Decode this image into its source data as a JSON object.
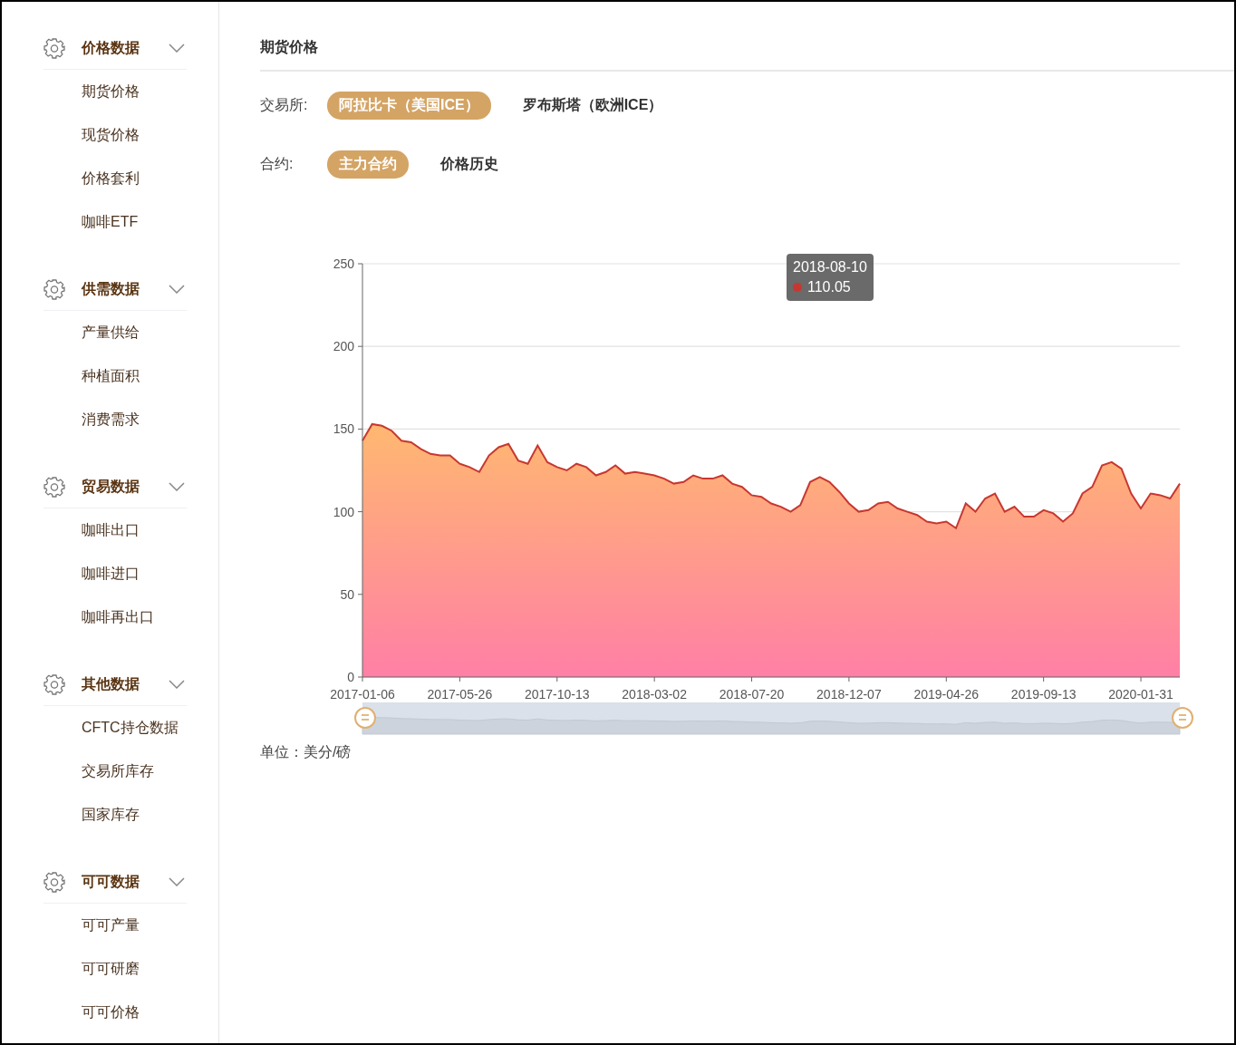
{
  "sidebar": {
    "sections": [
      {
        "title": "价格数据",
        "items": [
          "期货价格",
          "现货价格",
          "价格套利",
          "咖啡ETF"
        ]
      },
      {
        "title": "供需数据",
        "items": [
          "产量供给",
          "种植面积",
          "消费需求"
        ]
      },
      {
        "title": "贸易数据",
        "items": [
          "咖啡出口",
          "咖啡进口",
          "咖啡再出口"
        ]
      },
      {
        "title": "其他数据",
        "items": [
          "CFTC持仓数据",
          "交易所库存",
          "国家库存"
        ]
      },
      {
        "title": "可可数据",
        "items": [
          "可可产量",
          "可可研磨",
          "可可价格"
        ]
      }
    ]
  },
  "main": {
    "title": "期货价格",
    "filters": [
      {
        "label": "交易所:",
        "options": [
          {
            "label": "阿拉比卡（美国ICE）",
            "selected": true
          },
          {
            "label": "罗布斯塔（欧洲ICE）",
            "selected": false
          }
        ]
      },
      {
        "label": "合约:",
        "options": [
          {
            "label": "主力合约",
            "selected": true
          },
          {
            "label": "价格历史",
            "selected": false
          }
        ]
      }
    ],
    "chart_data": {
      "type": "area",
      "grid": true,
      "ylim": [
        0,
        250
      ],
      "yticks": [
        0,
        50,
        100,
        150,
        200,
        250
      ],
      "categories": [
        "2017-01-06",
        null,
        null,
        null,
        null,
        null,
        null,
        null,
        null,
        null,
        "2017-05-26",
        null,
        null,
        null,
        null,
        null,
        null,
        null,
        null,
        null,
        "2017-10-13",
        null,
        null,
        null,
        null,
        null,
        null,
        null,
        null,
        null,
        "2018-03-02",
        null,
        null,
        null,
        null,
        null,
        null,
        null,
        null,
        null,
        "2018-07-20",
        null,
        null,
        null,
        null,
        null,
        null,
        null,
        null,
        null,
        "2018-12-07",
        null,
        null,
        null,
        null,
        null,
        null,
        null,
        null,
        null,
        "2019-04-26",
        null,
        null,
        null,
        null,
        null,
        null,
        null,
        null,
        null,
        "2019-09-13",
        null,
        null,
        null,
        null,
        null,
        null,
        null,
        null,
        null,
        "2020-01-31",
        null,
        null,
        null,
        null
      ],
      "series": [
        {
          "color": "#c8372f",
          "values": [
            143,
            153,
            152,
            149,
            143,
            142,
            138,
            135,
            134,
            134,
            129,
            127,
            124,
            134,
            139,
            141,
            131,
            129,
            140,
            130,
            127,
            125,
            129,
            127,
            122,
            124,
            128,
            123,
            124,
            123,
            122,
            120,
            117,
            118,
            122,
            120,
            120,
            122,
            117,
            115,
            110,
            109,
            105,
            103,
            100,
            104,
            118,
            121,
            118,
            112,
            105,
            100,
            101,
            105,
            106,
            102,
            100,
            98,
            94,
            93,
            94,
            90,
            105,
            100,
            108,
            111,
            100,
            103,
            97,
            97,
            101,
            99,
            94,
            99,
            111,
            115,
            128,
            130,
            126,
            111,
            102,
            111,
            110,
            108,
            117
          ]
        }
      ]
    },
    "tooltip": {
      "date": "2018-08-10",
      "value": "110.05"
    },
    "unit": "单位：美分/磅"
  }
}
